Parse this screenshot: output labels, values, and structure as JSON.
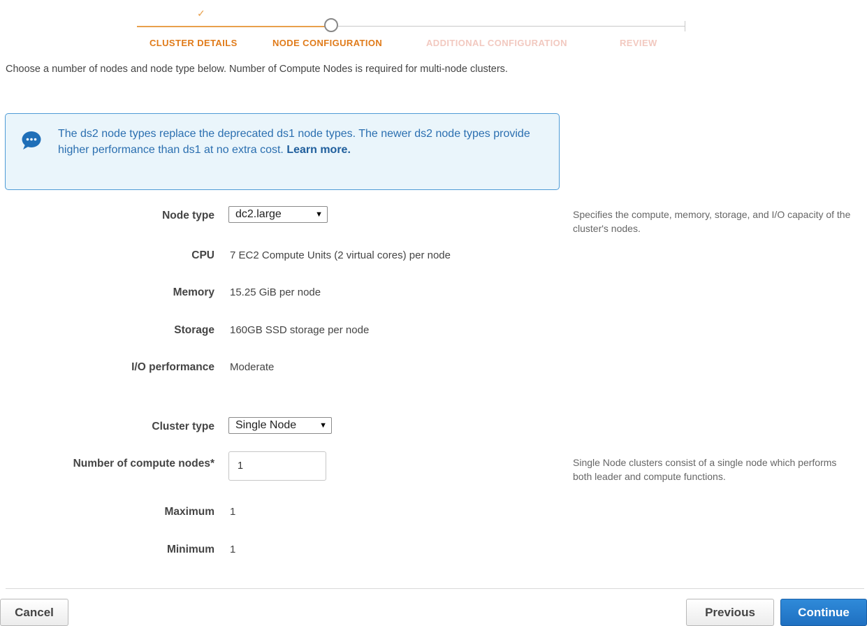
{
  "wizard": {
    "steps": [
      {
        "label": "CLUSTER DETAILS",
        "state": "done"
      },
      {
        "label": "NODE CONFIGURATION",
        "state": "current"
      },
      {
        "label": "ADDITIONAL CONFIGURATION",
        "state": "todo"
      },
      {
        "label": "REVIEW",
        "state": "todo"
      }
    ],
    "check_glyph": "✓"
  },
  "intro": "Choose a number of nodes and node type below. Number of Compute Nodes is required for multi-node clusters.",
  "info": {
    "icon": "chat-bubble-icon",
    "text": "The ds2 node types replace the deprecated ds1 node types. The newer ds2 node types provide higher performance than ds1 at no extra cost.",
    "link": "Learn more.",
    "color": "#2b6fb0"
  },
  "form": {
    "node_type": {
      "label": "Node type",
      "value": "dc2.large"
    },
    "cpu": {
      "label": "CPU",
      "value": "7 EC2 Compute Units (2 virtual cores) per node"
    },
    "memory": {
      "label": "Memory",
      "value": "15.25 GiB per node"
    },
    "storage": {
      "label": "Storage",
      "value": "160GB SSD storage per node"
    },
    "io": {
      "label": "I/O performance",
      "value": "Moderate"
    },
    "cluster_type": {
      "label": "Cluster type",
      "value": "Single Node"
    },
    "compute_nodes": {
      "label": "Number of compute nodes*",
      "value": "1"
    },
    "maximum": {
      "label": "Maximum",
      "value": "1"
    },
    "minimum": {
      "label": "Minimum",
      "value": "1"
    }
  },
  "help": {
    "node_type": "Specifies the compute, memory, storage, and I/O capacity of the cluster's nodes.",
    "cluster_type": "Single Node clusters consist of a single node which performs both leader and compute functions."
  },
  "buttons": {
    "cancel": "Cancel",
    "previous": "Previous",
    "continue": "Continue"
  },
  "colors": {
    "accent": "#e07b1a",
    "primary": "#1f70c1",
    "info_border": "#4e9bd6"
  }
}
